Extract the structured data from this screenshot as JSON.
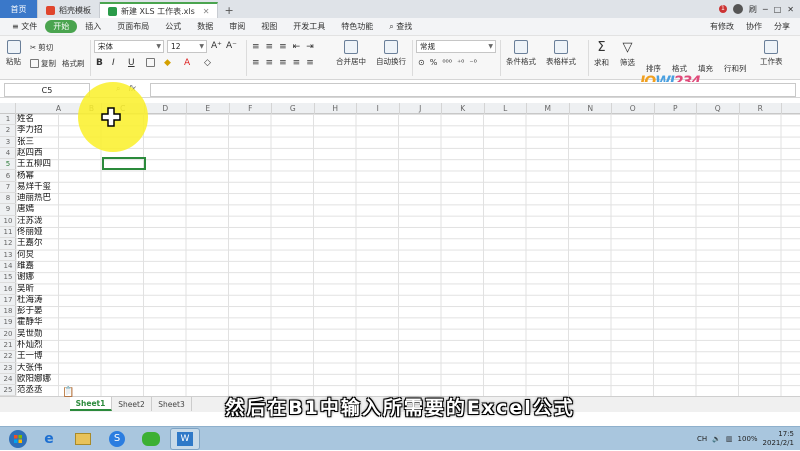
{
  "tabs": {
    "home": "首页",
    "template": "稻壳模板",
    "file": "新建 XLS 工作表.xls",
    "add": "+"
  },
  "window": {
    "badge": "1",
    "user": "刷"
  },
  "menu": {
    "file": "文件",
    "items": [
      "开始",
      "插入",
      "页面布局",
      "公式",
      "数据",
      "审阅",
      "视图",
      "开发工具",
      "特色功能"
    ],
    "search": "查找",
    "edited": "有修改",
    "collab": "协作",
    "share": "分享"
  },
  "ribbon": {
    "paste": "粘贴",
    "cut": "剪切",
    "copy": "复制",
    "format_painter": "格式刷",
    "font": "宋体",
    "size": "12",
    "merge": "合并居中",
    "wrap": "自动换行",
    "number_format": "常规",
    "cond_format": "条件格式",
    "table_style": "表格样式",
    "sum": "求和",
    "filter": "筛选",
    "sort": "排序",
    "format": "格式",
    "fill": "填充",
    "rowcol": "行和列",
    "sheet": "工作表",
    "bold": "B",
    "italic": "I",
    "underline": "U"
  },
  "formula_bar": {
    "name_box": "C5",
    "fx": "fx",
    "zoom_icon": "magnifier-icon"
  },
  "columns": [
    "A",
    "B",
    "C",
    "D",
    "E",
    "F",
    "G",
    "H",
    "I",
    "J",
    "K",
    "L",
    "M",
    "N",
    "O",
    "P",
    "Q",
    "R"
  ],
  "rows": [
    "1",
    "2",
    "3",
    "4",
    "5",
    "6",
    "7",
    "8",
    "9",
    "10",
    "11",
    "12",
    "13",
    "14",
    "15",
    "16",
    "17",
    "18",
    "19",
    "20",
    "21",
    "22",
    "23",
    "24",
    "25"
  ],
  "cells_a": [
    "姓名",
    "李力招",
    "张三",
    "赵四西",
    "王五柳四",
    "杨幂",
    "易烊千玺",
    "迪丽热巴",
    "唐嫣",
    "汪苏泷",
    "佟丽娅",
    "王嘉尔",
    "何炅",
    "维嘉",
    "谢娜",
    "吴昕",
    "杜海涛",
    "彭于晏",
    "霍静华",
    "吴世勋",
    "朴灿烈",
    "王一博",
    "大张伟",
    "欧阳娜娜",
    "范丞丞"
  ],
  "sheets": [
    "Sheet1",
    "Sheet2",
    "Sheet3"
  ],
  "subtitle": "然后在B1中输入所需要的Excel公式",
  "taskbar": {
    "lang": "CH",
    "zoom": "100%",
    "time": "17:5",
    "date": "2021/2/1"
  },
  "logo": "JOWI234",
  "colors": {
    "accent": "#4aa44f",
    "selection": "#2b8a3b",
    "highlight": "#faf028",
    "tab_home": "#3a78c9"
  }
}
